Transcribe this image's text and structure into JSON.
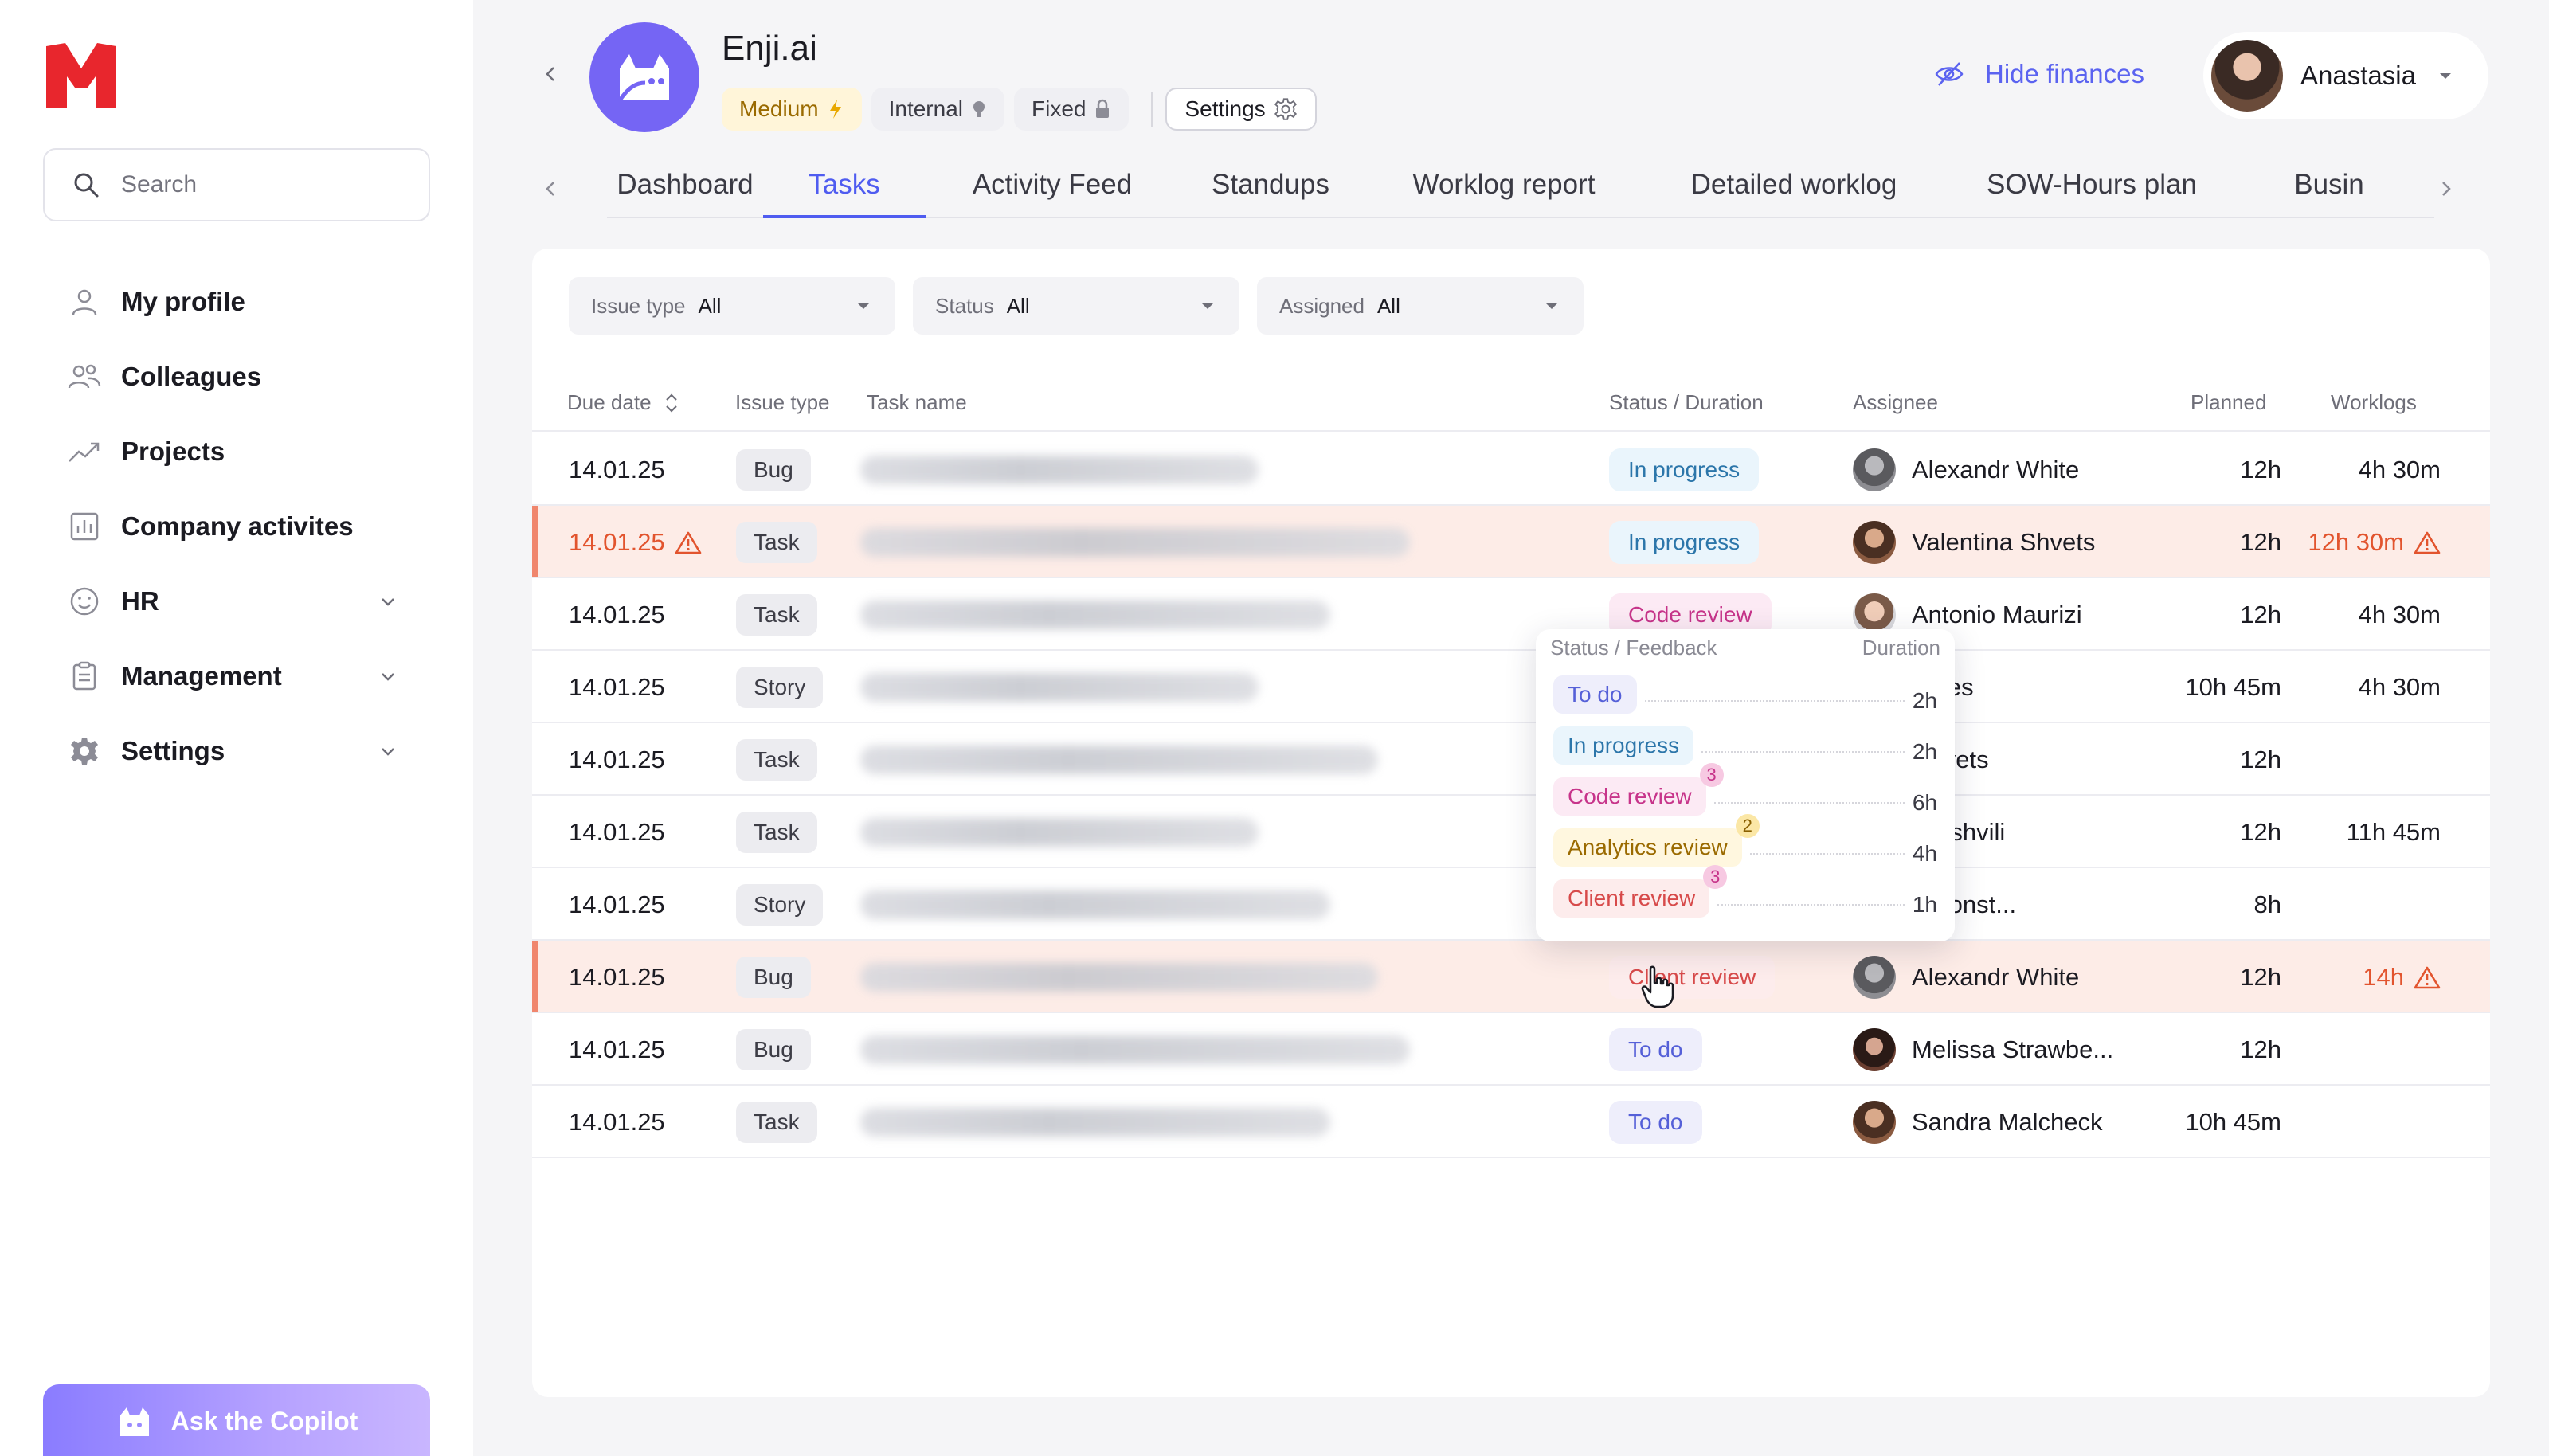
{
  "sidebar": {
    "search_placeholder": "Search",
    "items": [
      {
        "label": "My profile",
        "icon": "user-icon"
      },
      {
        "label": "Colleagues",
        "icon": "users-icon"
      },
      {
        "label": "Projects",
        "icon": "trend-icon"
      },
      {
        "label": "Company activites",
        "icon": "chart-icon"
      },
      {
        "label": "HR",
        "icon": "smile-icon",
        "expandable": true
      },
      {
        "label": "Management",
        "icon": "clipboard-icon",
        "expandable": true
      },
      {
        "label": "Settings",
        "icon": "gear-icon",
        "expandable": true
      }
    ],
    "copilot_label": "Ask the Copilot"
  },
  "header": {
    "project_title": "Enji.ai",
    "badges": {
      "medium": "Medium",
      "internal": "Internal",
      "fixed": "Fixed",
      "settings": "Settings"
    },
    "hide_finances": "Hide finances",
    "user_name": "Anastasia"
  },
  "tabs": [
    "Dashboard",
    "Tasks",
    "Activity Feed",
    "Standups",
    "Worklog report",
    "Detailed worklog",
    "SOW-Hours plan",
    "Busin"
  ],
  "active_tab": "Tasks",
  "filters": [
    {
      "label": "Issue type",
      "value": "All"
    },
    {
      "label": "Status",
      "value": "All"
    },
    {
      "label": "Assigned",
      "value": "All"
    }
  ],
  "table": {
    "columns": {
      "due_date": "Due date",
      "issue_type": "Issue type",
      "task_name": "Task name",
      "status": "Status / Duration",
      "assignee": "Assignee",
      "planned": "Planned",
      "worklogs": "Worklogs"
    },
    "rows": [
      {
        "due": "14.01.25",
        "type": "Bug",
        "status": "In progress",
        "status_kind": "inprogress",
        "assignee": "Alexandr White",
        "avatar": "grey",
        "planned": "12h",
        "worklogs": "4h 30m",
        "alert": false
      },
      {
        "due": "14.01.25",
        "type": "Task",
        "status": "In progress",
        "status_kind": "inprogress",
        "assignee": "Valentina Shvets",
        "avatar": "tan",
        "planned": "12h",
        "worklogs": "12h 30m",
        "alert": true
      },
      {
        "due": "14.01.25",
        "type": "Task",
        "status": "Code review",
        "status_kind": "codereview",
        "assignee": "Antonio Maurizi",
        "avatar": "light",
        "planned": "12h",
        "worklogs": "4h 30m",
        "alert": false
      },
      {
        "due": "14.01.25",
        "type": "Story",
        "status": "",
        "status_kind": "none",
        "assignee": "riel Markes",
        "avatar": "none",
        "planned": "10h 45m",
        "worklogs": "4h 30m",
        "alert": false
      },
      {
        "due": "14.01.25",
        "type": "Task",
        "status": "",
        "status_kind": "none",
        "assignee": "ntina Shvets",
        "avatar": "none",
        "planned": "12h",
        "worklogs": "",
        "alert": false
      },
      {
        "due": "14.01.25",
        "type": "Task",
        "status": "",
        "status_kind": "none",
        "assignee": "el Barniashvili",
        "avatar": "none",
        "planned": "12h",
        "worklogs": "11h 45m",
        "alert": false
      },
      {
        "due": "14.01.25",
        "type": "Story",
        "status": "",
        "status_kind": "none",
        "assignee": "stantin Konst...",
        "avatar": "none",
        "planned": "8h",
        "worklogs": "",
        "alert": false
      },
      {
        "due": "14.01.25",
        "type": "Bug",
        "status": "Client review",
        "status_kind": "clientreview",
        "assignee": "Alexandr White",
        "avatar": "grey",
        "planned": "12h",
        "worklogs": "14h",
        "alert": true,
        "due_alert": false
      },
      {
        "due": "14.01.25",
        "type": "Bug",
        "status": "To do",
        "status_kind": "todo",
        "assignee": "Melissa Strawbe...",
        "avatar": "dark",
        "planned": "12h",
        "worklogs": "",
        "alert": false
      },
      {
        "due": "14.01.25",
        "type": "Task",
        "status": "To do",
        "status_kind": "todo",
        "assignee": "Sandra Malcheck",
        "avatar": "tan",
        "planned": "10h 45m",
        "worklogs": "",
        "alert": false
      }
    ]
  },
  "popover": {
    "head_left": "Status / Feedback",
    "head_right": "Duration",
    "items": [
      {
        "label": "To do",
        "kind": "todo",
        "duration": "2h",
        "count": ""
      },
      {
        "label": "In progress",
        "kind": "inprogress",
        "duration": "2h",
        "count": ""
      },
      {
        "label": "Code review",
        "kind": "code",
        "duration": "6h",
        "count": "3"
      },
      {
        "label": "Analytics review",
        "kind": "analytics",
        "duration": "4h",
        "count": "2"
      },
      {
        "label": "Client review",
        "kind": "client",
        "duration": "1h",
        "count": "3"
      }
    ]
  },
  "colors": {
    "accent": "#4f5cf0",
    "alert": "#e2542e",
    "project_avatar": "#7565f4",
    "logo_red": "#e8262d"
  }
}
